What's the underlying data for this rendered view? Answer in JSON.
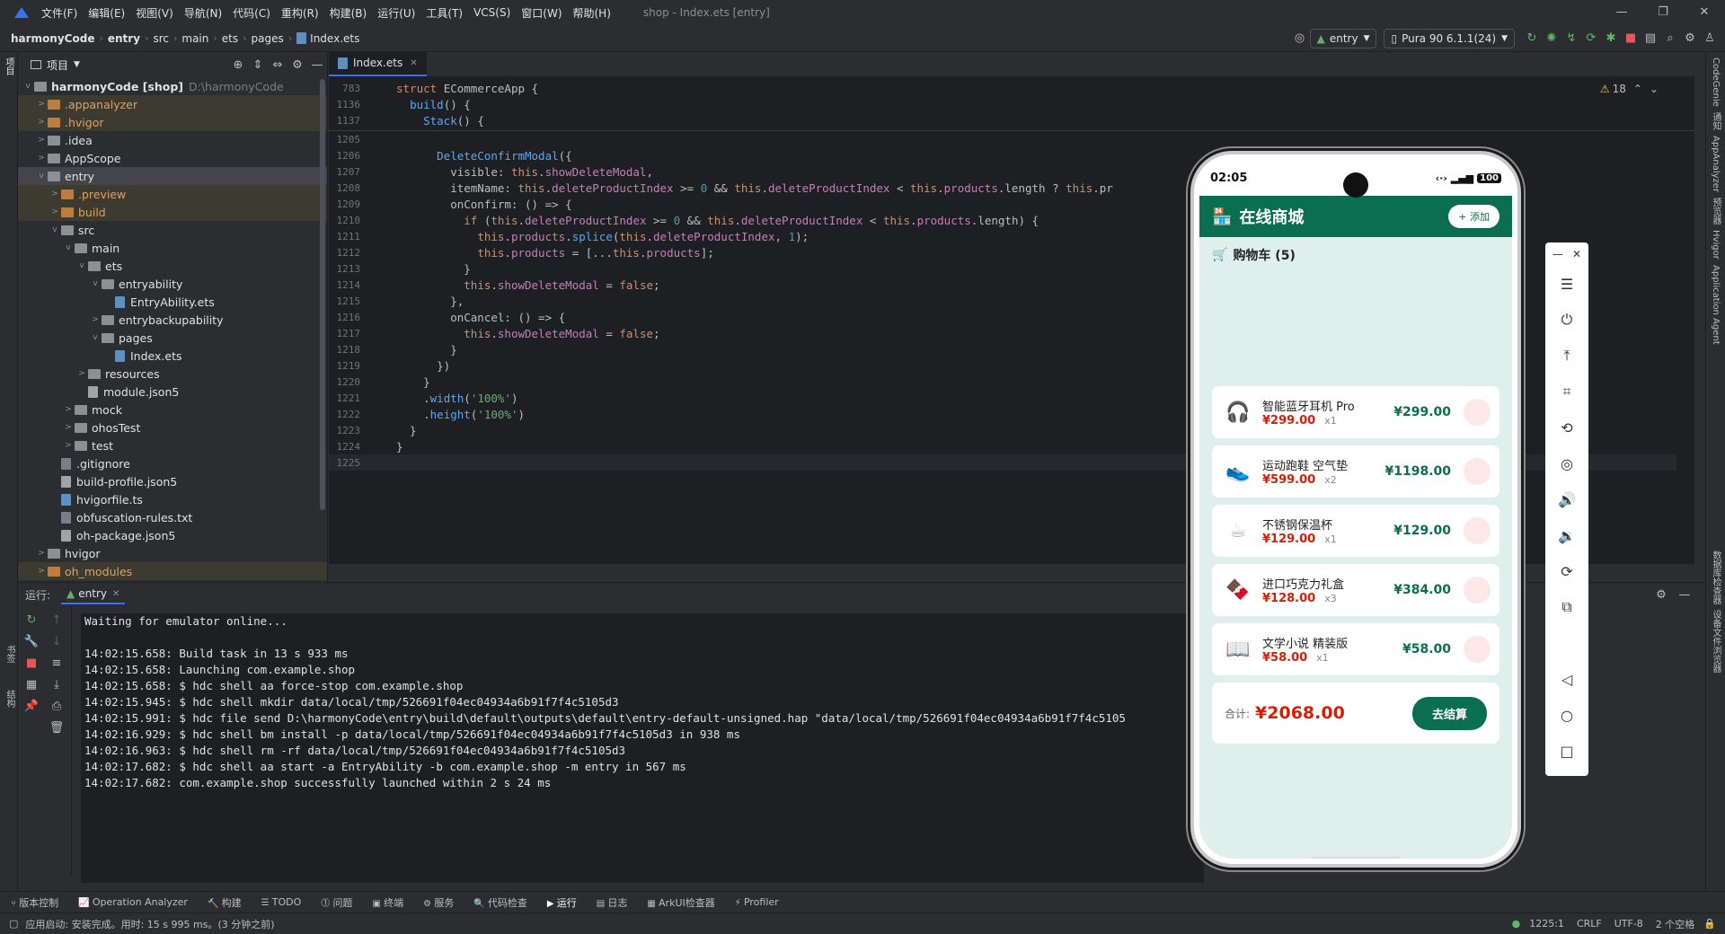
{
  "menubar": {
    "items": [
      "文件(F)",
      "编辑(E)",
      "视图(V)",
      "导航(N)",
      "代码(C)",
      "重构(R)",
      "构建(B)",
      "运行(U)",
      "工具(T)",
      "VCS(S)",
      "窗口(W)",
      "帮助(H)"
    ],
    "title": "shop - Index.ets [entry]"
  },
  "navbar": {
    "crumbs": [
      "harmonyCode",
      "entry",
      "src",
      "main",
      "ets",
      "pages",
      "Index.ets"
    ],
    "run_config": "entry",
    "device": "Pura 90 6.1.1(24)"
  },
  "project": {
    "header": "项目",
    "root": "harmonyCode [shop]",
    "root_path": "D:\\harmonyCode",
    "nodes": [
      {
        "label": ".appanalyzer",
        "depth": 1,
        "kind": "folder-orange",
        "arrow": ">",
        "ex": true
      },
      {
        "label": ".hvigor",
        "depth": 1,
        "kind": "folder-orange",
        "arrow": ">",
        "ex": true
      },
      {
        "label": ".idea",
        "depth": 1,
        "kind": "folder",
        "arrow": ">"
      },
      {
        "label": "AppScope",
        "depth": 1,
        "kind": "folder",
        "arrow": ">"
      },
      {
        "label": "entry",
        "depth": 1,
        "kind": "folder",
        "arrow": "v",
        "sel": true
      },
      {
        "label": ".preview",
        "depth": 2,
        "kind": "folder-orange",
        "arrow": ">",
        "ex": true
      },
      {
        "label": "build",
        "depth": 2,
        "kind": "folder-orange",
        "arrow": ">",
        "ex": true
      },
      {
        "label": "src",
        "depth": 2,
        "kind": "folder",
        "arrow": "v"
      },
      {
        "label": "main",
        "depth": 3,
        "kind": "folder",
        "arrow": "v"
      },
      {
        "label": "ets",
        "depth": 4,
        "kind": "folder",
        "arrow": "v"
      },
      {
        "label": "entryability",
        "depth": 5,
        "kind": "folder",
        "arrow": "v"
      },
      {
        "label": "EntryAbility.ets",
        "depth": 6,
        "kind": "ets",
        "arrow": ""
      },
      {
        "label": "entrybackupability",
        "depth": 5,
        "kind": "folder",
        "arrow": ">"
      },
      {
        "label": "pages",
        "depth": 5,
        "kind": "folder",
        "arrow": "v"
      },
      {
        "label": "Index.ets",
        "depth": 6,
        "kind": "ets",
        "arrow": ""
      },
      {
        "label": "resources",
        "depth": 4,
        "kind": "folder",
        "arrow": ">"
      },
      {
        "label": "module.json5",
        "depth": 4,
        "kind": "json",
        "arrow": ""
      },
      {
        "label": "mock",
        "depth": 3,
        "kind": "folder",
        "arrow": ">"
      },
      {
        "label": "ohosTest",
        "depth": 3,
        "kind": "folder",
        "arrow": ">"
      },
      {
        "label": "test",
        "depth": 3,
        "kind": "folder",
        "arrow": ">"
      },
      {
        "label": ".gitignore",
        "depth": 2,
        "kind": "file",
        "arrow": ""
      },
      {
        "label": "build-profile.json5",
        "depth": 2,
        "kind": "json",
        "arrow": ""
      },
      {
        "label": "hvigorfile.ts",
        "depth": 2,
        "kind": "ets",
        "arrow": ""
      },
      {
        "label": "obfuscation-rules.txt",
        "depth": 2,
        "kind": "file",
        "arrow": ""
      },
      {
        "label": "oh-package.json5",
        "depth": 2,
        "kind": "json",
        "arrow": ""
      },
      {
        "label": "hvigor",
        "depth": 1,
        "kind": "folder",
        "arrow": ">"
      },
      {
        "label": "oh_modules",
        "depth": 1,
        "kind": "folder-orange",
        "arrow": ">",
        "ex": true
      }
    ]
  },
  "editor": {
    "tab": "Index.ets",
    "warnings": "18",
    "sticky": [
      {
        "n": "783",
        "html": "<span class='kw'>struct</span> <span class='ty'>ECommerceApp</span> {"
      },
      {
        "n": "1136",
        "html": "  <span class='fn'>build</span>() {"
      },
      {
        "n": "1137",
        "html": "    <span class='fn'>Stack</span>() {"
      }
    ],
    "lines": [
      {
        "n": "1205",
        "html": ""
      },
      {
        "n": "1206",
        "html": "      <span class='fn'>DeleteConfirmModal</span>({"
      },
      {
        "n": "1207",
        "html": "        visible: <span class='kw'>this</span>.<span class='prop'>showDeleteModal</span>,"
      },
      {
        "n": "1208",
        "html": "        itemName: <span class='kw'>this</span>.<span class='prop'>deleteProductIndex</span> >= <span class='nm'>0</span> && <span class='kw'>this</span>.<span class='prop'>deleteProductIndex</span> < <span class='kw'>this</span>.<span class='prop'>products</span>.length ? <span class='kw'>this</span>.pr"
      },
      {
        "n": "1209",
        "html": "        onConfirm: () => {"
      },
      {
        "n": "1210",
        "html": "          <span class='kw'>if</span> (<span class='kw'>this</span>.<span class='prop'>deleteProductIndex</span> >= <span class='nm'>0</span> && <span class='kw'>this</span>.<span class='prop'>deleteProductIndex</span> < <span class='kw'>this</span>.<span class='prop'>products</span>.length) {"
      },
      {
        "n": "1211",
        "html": "            <span class='kw'>this</span>.<span class='prop'>products</span>.<span class='fn'>splice</span>(<span class='kw'>this</span>.<span class='prop'>deleteProductIndex</span>, <span class='nm'>1</span>);"
      },
      {
        "n": "1212",
        "html": "            <span class='kw'>this</span>.<span class='prop'>products</span> = [...<span class='kw'>this</span>.<span class='prop'>products</span>];"
      },
      {
        "n": "1213",
        "html": "          }"
      },
      {
        "n": "1214",
        "html": "          <span class='kw'>this</span>.<span class='prop'>showDeleteModal</span> = <span class='kw'>false</span>;"
      },
      {
        "n": "1215",
        "html": "        },"
      },
      {
        "n": "1216",
        "html": "        onCancel: () => {"
      },
      {
        "n": "1217",
        "html": "          <span class='kw'>this</span>.<span class='prop'>showDeleteModal</span> = <span class='kw'>false</span>;"
      },
      {
        "n": "1218",
        "html": "        }"
      },
      {
        "n": "1219",
        "html": "      })"
      },
      {
        "n": "1220",
        "html": "    }"
      },
      {
        "n": "1221",
        "html": "    .<span class='fn'>width</span>(<span class='str'>'100%'</span>)"
      },
      {
        "n": "1222",
        "html": "    .<span class='fn'>height</span>(<span class='str'>'100%'</span>)"
      },
      {
        "n": "1223",
        "html": "  }"
      },
      {
        "n": "1224",
        "html": "}"
      },
      {
        "n": "1225",
        "html": "",
        "cur": true
      }
    ]
  },
  "run": {
    "label": "运行:",
    "tab": "entry",
    "console": [
      "Waiting for emulator online...",
      "",
      "14:02:15.658: Build task in 13 s 933 ms",
      "14:02:15.658: Launching com.example.shop",
      "14:02:15.658: $ hdc shell aa force-stop com.example.shop",
      "14:02:15.945: $ hdc shell mkdir data/local/tmp/526691f04ec04934a6b91f7f4c5105d3",
      "14:02:15.991: $ hdc file send D:\\harmonyCode\\entry\\build\\default\\outputs\\default\\entry-default-unsigned.hap \"data/local/tmp/526691f04ec04934a6b91f7f4c5105",
      "14:02:16.929: $ hdc shell bm install -p data/local/tmp/526691f04ec04934a6b91f7f4c5105d3 in 938 ms",
      "14:02:16.963: $ hdc shell rm -rf data/local/tmp/526691f04ec04934a6b91f7f4c5105d3",
      "14:02:17.682: $ hdc shell aa start -a EntryAbility -b com.example.shop -m entry in 567 ms",
      "14:02:17.682: com.example.shop successfully launched within 2 s 24 ms"
    ]
  },
  "phone": {
    "time": "02:05",
    "battery": "100",
    "app_title": "在线商城",
    "add_btn": "+ 添加",
    "cart_title": "购物车 (5)",
    "items": [
      {
        "icon": "🎧",
        "name": "智能蓝牙耳机 Pro",
        "price": "¥299.00",
        "qty": "x1",
        "total": "¥299.00"
      },
      {
        "icon": "👟",
        "name": "运动跑鞋 空气垫",
        "price": "¥599.00",
        "qty": "x2",
        "total": "¥1198.00"
      },
      {
        "icon": "☕",
        "name": "不锈钢保温杯",
        "price": "¥129.00",
        "qty": "x1",
        "total": "¥129.00"
      },
      {
        "icon": "🍫",
        "name": "进口巧克力礼盒",
        "price": "¥128.00",
        "qty": "x3",
        "total": "¥384.00"
      },
      {
        "icon": "📖",
        "name": "文学小说 精装版",
        "price": "¥58.00",
        "qty": "x1",
        "total": "¥58.00"
      }
    ],
    "sum_label": "合计:",
    "sum_amount": "¥2068.00",
    "checkout": "去结算"
  },
  "bottombar": {
    "items": [
      "版本控制",
      "Operation Analyzer",
      "构建",
      "TODO",
      "问题",
      "终端",
      "服务",
      "代码检查",
      "运行",
      "日志",
      "ArkUI检查器",
      "Profiler"
    ]
  },
  "rightstrip": {
    "items": [
      "CodeGenie",
      "通知",
      "AppAnalyzer",
      "预览器",
      "Hvigor",
      "Application Agent",
      "数据库检查器",
      "设备文件浏览器"
    ]
  },
  "leftstrip": {
    "items": [
      "项目",
      "书签",
      "结构"
    ]
  },
  "statusbar": {
    "message": "应用启动: 安装完成。用时: 15 s 995 ms。(3 分钟之前)",
    "pos": "1225:1",
    "eol": "CRLF",
    "enc": "UTF-8",
    "indent": "2 个空格"
  }
}
